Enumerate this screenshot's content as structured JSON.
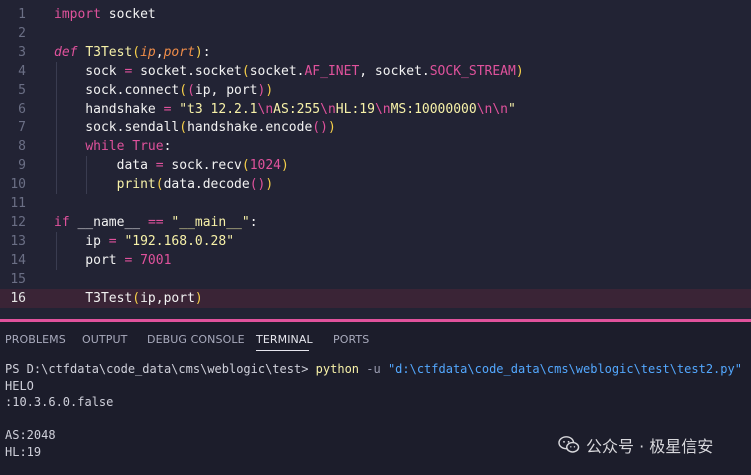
{
  "editor": {
    "lines": [
      {
        "n": "1",
        "tokens": [
          [
            "kw",
            "import"
          ],
          [
            "plain",
            " socket"
          ]
        ]
      },
      {
        "n": "2",
        "tokens": []
      },
      {
        "n": "3",
        "tokens": [
          [
            "def",
            "def"
          ],
          [
            "plain",
            " "
          ],
          [
            "fn",
            "T3Test"
          ],
          [
            "b1",
            "("
          ],
          [
            "param",
            "ip"
          ],
          [
            "plain",
            ","
          ],
          [
            "param",
            "port"
          ],
          [
            "b1",
            ")"
          ],
          [
            "plain",
            ":"
          ]
        ]
      },
      {
        "n": "4",
        "tokens": [
          [
            "plain",
            "    sock "
          ],
          [
            "op",
            "="
          ],
          [
            "plain",
            " socket.socket"
          ],
          [
            "b1",
            "("
          ],
          [
            "plain",
            "socket."
          ],
          [
            "const",
            "AF_INET"
          ],
          [
            "plain",
            ", socket."
          ],
          [
            "const",
            "SOCK_STREAM"
          ],
          [
            "b1",
            ")"
          ]
        ]
      },
      {
        "n": "5",
        "tokens": [
          [
            "plain",
            "    sock.connect"
          ],
          [
            "b1",
            "("
          ],
          [
            "b2",
            "("
          ],
          [
            "plain",
            "ip, port"
          ],
          [
            "b2",
            ")"
          ],
          [
            "b1",
            ")"
          ]
        ]
      },
      {
        "n": "6",
        "tokens": [
          [
            "plain",
            "    handshake "
          ],
          [
            "op",
            "="
          ],
          [
            "plain",
            " "
          ],
          [
            "str",
            "\"t3 12.2.1"
          ],
          [
            "esc",
            "\\n"
          ],
          [
            "str",
            "AS:255"
          ],
          [
            "esc",
            "\\n"
          ],
          [
            "str",
            "HL:19"
          ],
          [
            "esc",
            "\\n"
          ],
          [
            "str",
            "MS:10000000"
          ],
          [
            "esc",
            "\\n\\n"
          ],
          [
            "str",
            "\""
          ]
        ]
      },
      {
        "n": "7",
        "tokens": [
          [
            "plain",
            "    sock.sendall"
          ],
          [
            "b1",
            "("
          ],
          [
            "plain",
            "handshake.encode"
          ],
          [
            "b2",
            "()"
          ],
          [
            "b1",
            ")"
          ]
        ]
      },
      {
        "n": "8",
        "tokens": [
          [
            "plain",
            "    "
          ],
          [
            "kw",
            "while"
          ],
          [
            "plain",
            " "
          ],
          [
            "true",
            "True"
          ],
          [
            "plain",
            ":"
          ]
        ]
      },
      {
        "n": "9",
        "tokens": [
          [
            "plain",
            "        data "
          ],
          [
            "op",
            "="
          ],
          [
            "plain",
            " sock.recv"
          ],
          [
            "b1",
            "("
          ],
          [
            "num",
            "1024"
          ],
          [
            "b1",
            ")"
          ]
        ]
      },
      {
        "n": "10",
        "tokens": [
          [
            "plain",
            "        "
          ],
          [
            "builtin",
            "print"
          ],
          [
            "b1",
            "("
          ],
          [
            "plain",
            "data.decode"
          ],
          [
            "b2",
            "()"
          ],
          [
            "b1",
            ")"
          ]
        ]
      },
      {
        "n": "11",
        "tokens": []
      },
      {
        "n": "12",
        "tokens": [
          [
            "kw",
            "if"
          ],
          [
            "plain",
            " __name__ "
          ],
          [
            "op",
            "=="
          ],
          [
            "plain",
            " "
          ],
          [
            "str",
            "\"__main__\""
          ],
          [
            "plain",
            ":"
          ]
        ]
      },
      {
        "n": "13",
        "tokens": [
          [
            "plain",
            "    ip "
          ],
          [
            "op",
            "="
          ],
          [
            "plain",
            " "
          ],
          [
            "str",
            "\"192.168.0.28\""
          ]
        ]
      },
      {
        "n": "14",
        "tokens": [
          [
            "plain",
            "    port "
          ],
          [
            "op",
            "="
          ],
          [
            "plain",
            " "
          ],
          [
            "num",
            "7001"
          ]
        ]
      },
      {
        "n": "15",
        "tokens": []
      },
      {
        "n": "16",
        "tokens": [
          [
            "plain",
            "    T3Test"
          ],
          [
            "b1",
            "("
          ],
          [
            "plain",
            "ip,port"
          ],
          [
            "b1",
            ")"
          ]
        ],
        "active": true
      }
    ]
  },
  "panel": {
    "tabs": [
      {
        "label": "PROBLEMS",
        "active": false
      },
      {
        "label": "OUTPUT",
        "active": false
      },
      {
        "label": "DEBUG CONSOLE",
        "active": false
      },
      {
        "label": "TERMINAL",
        "active": true
      },
      {
        "label": "PORTS",
        "active": false
      }
    ]
  },
  "terminal": {
    "prompt": "PS D:\\ctfdata\\code_data\\cms\\weblogic\\test> ",
    "command": "python",
    "flag": " -u ",
    "arg": "\"d:\\ctfdata\\code_data\\cms\\weblogic\\test\\test2.py\"",
    "output": [
      "HELO",
      ":10.3.6.0.false",
      "",
      "AS:2048",
      "HL:19"
    ]
  },
  "watermark": {
    "text": "公众号 · 极星信安",
    "icon": "wechat-icon"
  }
}
